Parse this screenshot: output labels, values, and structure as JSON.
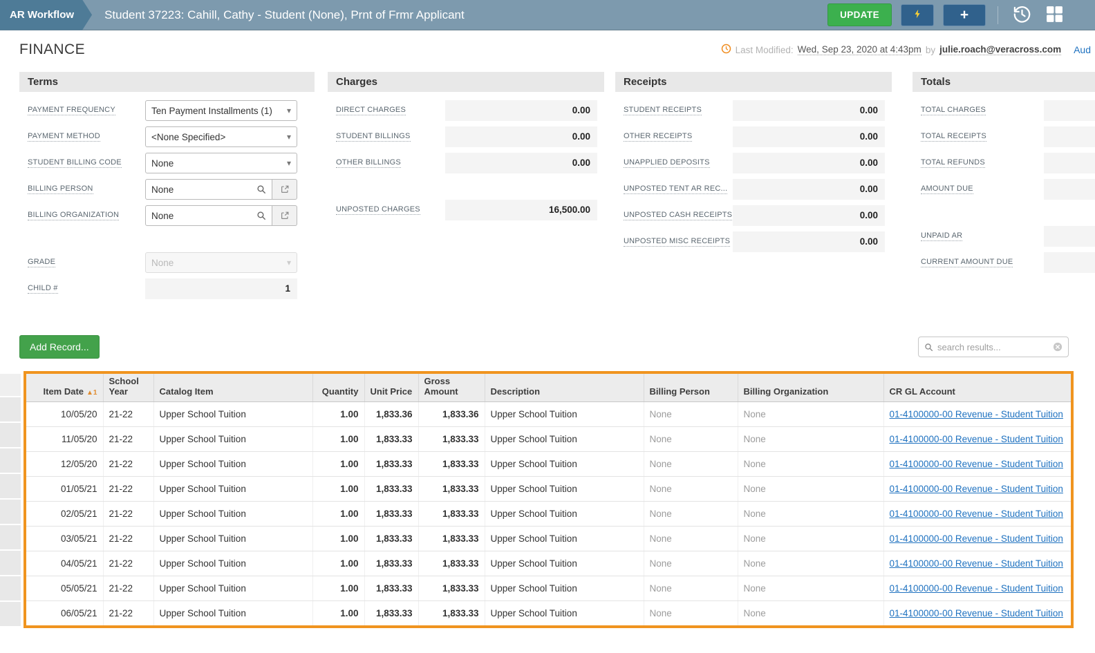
{
  "colors": {
    "topbar-bg": "#7d9aae",
    "breadcrumb-bg": "#4e7b97",
    "update-green": "#3cb04e",
    "add-green": "#43a24b",
    "button-navy": "#30618c",
    "bolt-yellow": "#ffd234",
    "highlight-orange": "#f0941f",
    "link-blue": "#1f72c0",
    "sort-orange": "#e08b2d",
    "modified-orange": "#f08c1e"
  },
  "topbar": {
    "breadcrumb": "AR Workflow",
    "title": "Student 37223: Cahill, Cathy - Student (None), Prnt of Frmr Applicant",
    "update_label": "UPDATE"
  },
  "header": {
    "page_title": "FINANCE",
    "last_modified_prefix": "Last Modified:",
    "last_modified_date": "Wed, Sep 23, 2020 at 4:43pm",
    "by_label": "by",
    "last_modified_user": "julie.roach@veracross.com",
    "audit_link": "Aud"
  },
  "panels": {
    "terms": {
      "title": "Terms",
      "fields": [
        {
          "label": "PAYMENT FREQUENCY",
          "type": "select",
          "value": "Ten Payment Installments (1)"
        },
        {
          "label": "PAYMENT METHOD",
          "type": "select",
          "value": "<None Specified>"
        },
        {
          "label": "STUDENT BILLING CODE",
          "type": "select",
          "value": "None"
        },
        {
          "label": "BILLING PERSON",
          "type": "lookup",
          "value": "None"
        },
        {
          "label": "BILLING ORGANIZATION",
          "type": "lookup",
          "value": "None"
        },
        {
          "label": "GRADE",
          "type": "select-disabled",
          "value": "None",
          "gap_before": true
        },
        {
          "label": "CHILD #",
          "type": "readonly",
          "value": "1"
        }
      ]
    },
    "charges": {
      "title": "Charges",
      "fields": [
        {
          "label": "DIRECT CHARGES",
          "value": "0.00"
        },
        {
          "label": "STUDENT BILLINGS",
          "value": "0.00"
        },
        {
          "label": "OTHER BILLINGS",
          "value": "0.00"
        },
        {
          "label": "UNPOSTED CHARGES",
          "value": "16,500.00",
          "gap_before": true
        }
      ]
    },
    "receipts": {
      "title": "Receipts",
      "fields": [
        {
          "label": "STUDENT RECEIPTS",
          "value": "0.00"
        },
        {
          "label": "OTHER RECEIPTS",
          "value": "0.00"
        },
        {
          "label": "UNAPPLIED DEPOSITS",
          "value": "0.00"
        },
        {
          "label": "UNPOSTED TENT AR REC...",
          "value": "0.00"
        },
        {
          "label": "UNPOSTED CASH RECEIPTS",
          "value": "0.00"
        },
        {
          "label": "UNPOSTED MISC RECEIPTS",
          "value": "0.00"
        }
      ]
    },
    "totals": {
      "title": "Totals",
      "fields": [
        {
          "label": "TOTAL CHARGES",
          "value": ""
        },
        {
          "label": "TOTAL RECEIPTS",
          "value": ""
        },
        {
          "label": "TOTAL REFUNDS",
          "value": ""
        },
        {
          "label": "AMOUNT DUE",
          "value": ""
        },
        {
          "label": "UNPAID AR",
          "value": "",
          "gap_before": true
        },
        {
          "label": "CURRENT AMOUNT DUE",
          "value": ""
        }
      ]
    }
  },
  "actions": {
    "add_record_label": "Add Record...",
    "search_placeholder": "search results..."
  },
  "table": {
    "columns": [
      "Item Date",
      "School Year",
      "Catalog Item",
      "Quantity",
      "Unit Price",
      "Gross Amount",
      "Description",
      "Billing Person",
      "Billing Organization",
      "CR GL Account"
    ],
    "sort_column": "Item Date",
    "sort_indicator": "1",
    "rows": [
      {
        "item_date": "10/05/20",
        "school_year": "21-22",
        "catalog_item": "Upper School Tuition",
        "quantity": "1.00",
        "unit_price": "1,833.36",
        "gross_amount": "1,833.36",
        "description": "Upper School Tuition",
        "billing_person": "None",
        "billing_organization": "None",
        "cr_gl_account": "01-4100000-00 Revenue - Student Tuition"
      },
      {
        "item_date": "11/05/20",
        "school_year": "21-22",
        "catalog_item": "Upper School Tuition",
        "quantity": "1.00",
        "unit_price": "1,833.33",
        "gross_amount": "1,833.33",
        "description": "Upper School Tuition",
        "billing_person": "None",
        "billing_organization": "None",
        "cr_gl_account": "01-4100000-00 Revenue - Student Tuition"
      },
      {
        "item_date": "12/05/20",
        "school_year": "21-22",
        "catalog_item": "Upper School Tuition",
        "quantity": "1.00",
        "unit_price": "1,833.33",
        "gross_amount": "1,833.33",
        "description": "Upper School Tuition",
        "billing_person": "None",
        "billing_organization": "None",
        "cr_gl_account": "01-4100000-00 Revenue - Student Tuition"
      },
      {
        "item_date": "01/05/21",
        "school_year": "21-22",
        "catalog_item": "Upper School Tuition",
        "quantity": "1.00",
        "unit_price": "1,833.33",
        "gross_amount": "1,833.33",
        "description": "Upper School Tuition",
        "billing_person": "None",
        "billing_organization": "None",
        "cr_gl_account": "01-4100000-00 Revenue - Student Tuition"
      },
      {
        "item_date": "02/05/21",
        "school_year": "21-22",
        "catalog_item": "Upper School Tuition",
        "quantity": "1.00",
        "unit_price": "1,833.33",
        "gross_amount": "1,833.33",
        "description": "Upper School Tuition",
        "billing_person": "None",
        "billing_organization": "None",
        "cr_gl_account": "01-4100000-00 Revenue - Student Tuition"
      },
      {
        "item_date": "03/05/21",
        "school_year": "21-22",
        "catalog_item": "Upper School Tuition",
        "quantity": "1.00",
        "unit_price": "1,833.33",
        "gross_amount": "1,833.33",
        "description": "Upper School Tuition",
        "billing_person": "None",
        "billing_organization": "None",
        "cr_gl_account": "01-4100000-00 Revenue - Student Tuition"
      },
      {
        "item_date": "04/05/21",
        "school_year": "21-22",
        "catalog_item": "Upper School Tuition",
        "quantity": "1.00",
        "unit_price": "1,833.33",
        "gross_amount": "1,833.33",
        "description": "Upper School Tuition",
        "billing_person": "None",
        "billing_organization": "None",
        "cr_gl_account": "01-4100000-00 Revenue - Student Tuition"
      },
      {
        "item_date": "05/05/21",
        "school_year": "21-22",
        "catalog_item": "Upper School Tuition",
        "quantity": "1.00",
        "unit_price": "1,833.33",
        "gross_amount": "1,833.33",
        "description": "Upper School Tuition",
        "billing_person": "None",
        "billing_organization": "None",
        "cr_gl_account": "01-4100000-00 Revenue - Student Tuition"
      },
      {
        "item_date": "06/05/21",
        "school_year": "21-22",
        "catalog_item": "Upper School Tuition",
        "quantity": "1.00",
        "unit_price": "1,833.33",
        "gross_amount": "1,833.33",
        "description": "Upper School Tuition",
        "billing_person": "None",
        "billing_organization": "None",
        "cr_gl_account": "01-4100000-00 Revenue - Student Tuition"
      }
    ]
  },
  "icons": {
    "caret": "▾",
    "sort_arrow": "▲"
  }
}
